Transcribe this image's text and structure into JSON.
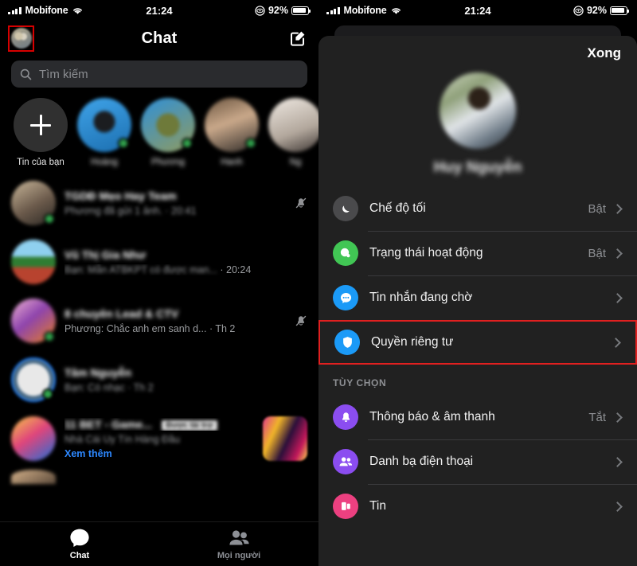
{
  "status_bar": {
    "carrier": "Mobifone",
    "time": "21:24",
    "battery_percent": "92%",
    "signal_icon": "signal-bars-icon",
    "wifi_icon": "wifi-icon",
    "focus_icon": "do-not-disturb-icon",
    "battery_icon": "battery-icon"
  },
  "left_panel": {
    "nav": {
      "title": "Chat",
      "avatar_icon": "profile-avatar",
      "compose_icon": "compose-icon",
      "avatar_highlighted": true,
      "highlight_color": "#d60000"
    },
    "search": {
      "placeholder": "Tìm kiếm",
      "icon": "search-icon"
    },
    "stories": [
      {
        "label": "Tin của bạn",
        "type": "add",
        "icon": "plus-icon",
        "online": false,
        "blurred": false
      },
      {
        "label": "Hoàng",
        "type": "photo",
        "online": true,
        "blurred": true
      },
      {
        "label": "Phương",
        "type": "photo",
        "online": true,
        "blurred": true
      },
      {
        "label": "Hanh",
        "type": "photo",
        "online": true,
        "blurred": true
      },
      {
        "label": "Ng",
        "type": "photo",
        "online": false,
        "blurred": true
      }
    ],
    "chats": [
      {
        "name": "TGDĐ Mẹo Hay Team",
        "preview": "Phương đã gửi 1 ảnh.",
        "time": "20:41",
        "online": true,
        "muted": true,
        "blurred": true,
        "sponsored": false
      },
      {
        "name": "Vũ Thị Gia Như",
        "preview": "Bạn: Mẫn ATBKPT có được man...",
        "time": "20:24",
        "online": false,
        "muted": false,
        "blurred": true,
        "sponsored": false
      },
      {
        "name": "8 chuyên Lead & CTV",
        "preview": "Phương: Chắc anh em sanh d...",
        "time": "Th 2",
        "online": true,
        "muted": true,
        "blurred": true,
        "sponsored": false
      },
      {
        "name": "Tâm Nguyễn",
        "preview": "Bạn: Có nhạc",
        "time": "Th 2",
        "online": true,
        "muted": false,
        "blurred": true,
        "sponsored": false
      },
      {
        "name": "11 BET - Game...",
        "preview": "Nhà Cái Uy Tín Hàng Đầu",
        "time": "",
        "cta": "Xem thêm",
        "badge": "Được tài trợ",
        "online": false,
        "muted": false,
        "blurred": true,
        "sponsored": true
      }
    ],
    "tabs": [
      {
        "label": "Chat",
        "icon": "chat-bubble-icon",
        "active": true
      },
      {
        "label": "Mọi người",
        "icon": "people-icon",
        "active": false
      }
    ]
  },
  "right_panel": {
    "done_label": "Xong",
    "profile": {
      "name": "Huy Nguyễn",
      "avatar_icon": "profile-avatar-large"
    },
    "settings": [
      {
        "label": "Chế độ tối",
        "value": "Bật",
        "icon": "moon-icon",
        "icon_color": "#4a4a4c",
        "highlighted": false
      },
      {
        "label": "Trạng thái hoạt động",
        "value": "Bật",
        "icon": "active-status-icon",
        "icon_color": "#41c654",
        "highlighted": false
      },
      {
        "label": "Tin nhắn đang chờ",
        "value": "",
        "icon": "message-requests-icon",
        "icon_color": "#1b9af7",
        "highlighted": false
      },
      {
        "label": "Quyền riêng tư",
        "value": "",
        "icon": "shield-icon",
        "icon_color": "#1b9af7",
        "highlighted": true
      }
    ],
    "section_header": "TÙY CHỌN",
    "options": [
      {
        "label": "Thông báo & âm thanh",
        "value": "Tắt",
        "icon": "bell-icon",
        "icon_color": "#8b4df0",
        "highlighted": false
      },
      {
        "label": "Danh bạ điện thoại",
        "value": "",
        "icon": "contacts-icon",
        "icon_color": "#8b4df0",
        "highlighted": false
      },
      {
        "label": "Tin",
        "value": "",
        "icon": "stories-icon",
        "icon_color": "#ec4080",
        "highlighted": false
      }
    ],
    "highlight_color": "#e02020"
  }
}
